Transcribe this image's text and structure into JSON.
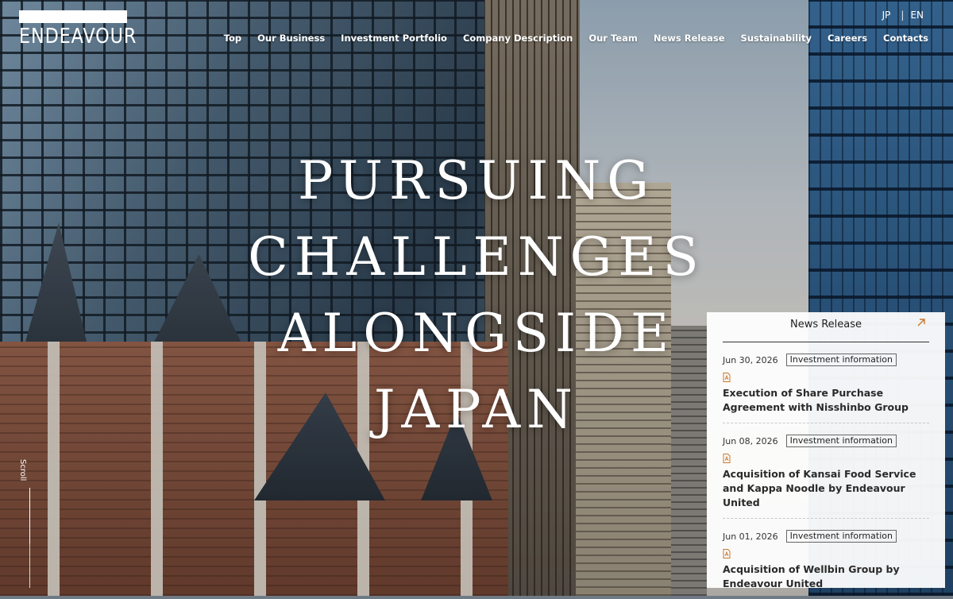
{
  "header": {
    "logo_text": "ENDEAVOUR",
    "lang": {
      "jp": "JP",
      "separator": "|",
      "en": "EN"
    },
    "nav": [
      "Top",
      "Our Business",
      "Investment Portfolio",
      "Company Description",
      "Our Team",
      "News Release",
      "Sustainability",
      "Careers",
      "Contacts"
    ]
  },
  "hero": {
    "lines": [
      "PURSUING",
      "CHALLENGES",
      "ALONGSIDE",
      "JAPAN"
    ]
  },
  "scroll": {
    "label": "Scroll"
  },
  "news": {
    "title": "News Release",
    "items": [
      {
        "date": "Jun 30, 2026",
        "category": "Investment information",
        "title": "Execution of Share Purchase Agreement with Nisshinbo Group"
      },
      {
        "date": "Jun 08, 2026",
        "category": "Investment information",
        "title": "Acquisition of Kansai Food Service and Kappa Noodle by Endeavour United"
      },
      {
        "date": "Jun 01, 2026",
        "category": "Investment information",
        "title": "Acquisition of Wellbin Group by Endeavour United"
      }
    ]
  },
  "colors": {
    "accent": "#c8782a",
    "panel_bg": "#ffffff",
    "text_dark": "#1e1e1e"
  },
  "icons": {
    "news_link": "arrow-up-right-icon",
    "pdf": "pdf-icon"
  }
}
